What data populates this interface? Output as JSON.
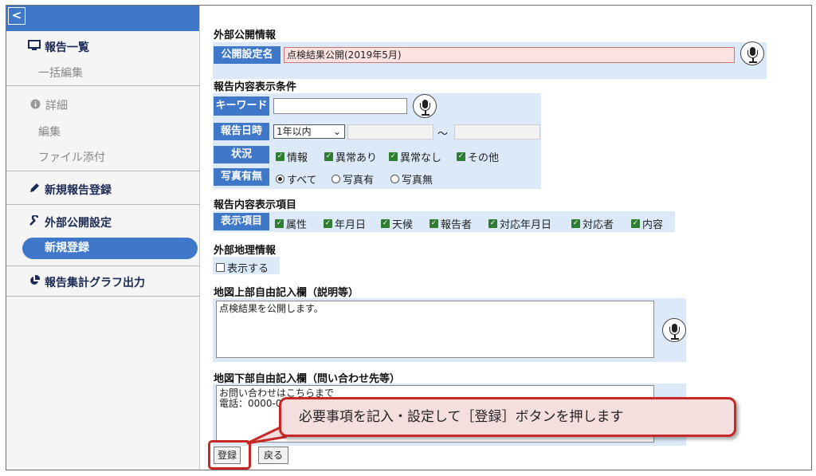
{
  "sidebar": {
    "back_glyph": "<",
    "items": [
      {
        "label": "報告一覧",
        "icon": "monitor-icon"
      },
      {
        "label": "一括編集"
      },
      {
        "label": "詳細",
        "icon": "info-icon"
      },
      {
        "label": "編集"
      },
      {
        "label": "ファイル添付"
      },
      {
        "label": "新規報告登録",
        "icon": "pencil-icon"
      },
      {
        "label": "外部公開設定",
        "icon": "wrench-icon"
      },
      {
        "label": "新規登録"
      },
      {
        "label": "報告集計グラフ出力",
        "icon": "pie-chart-icon"
      }
    ]
  },
  "form": {
    "section_public_info": "外部公開情報",
    "public_name_label": "公開設定名",
    "public_name_value": "点検結果公開(2019年5月)",
    "section_conditions": "報告内容表示条件",
    "keyword_label": "キーワード",
    "keyword_value": "",
    "date_label": "報告日時",
    "date_select": "1年以内",
    "date_tilde": "～",
    "status_label": "状況",
    "status_options": [
      "情報",
      "異常あり",
      "異常なし",
      "その他"
    ],
    "photo_label": "写真有無",
    "photo_options": [
      "すべて",
      "写真有",
      "写真無"
    ],
    "section_items": "報告内容表示項目",
    "items_label": "表示項目",
    "item_options": [
      "属性",
      "年月日",
      "天候",
      "報告者",
      "対応年月日",
      "対応者",
      "内容"
    ],
    "section_geo": "外部地理情報",
    "geo_checkbox": "表示する",
    "section_map_top": "地図上部自由記入欄（説明等）",
    "map_top_text": "点検結果を公開します。",
    "section_map_bottom": "地図下部自由記入欄（問い合わせ先等）",
    "map_bottom_text": "お問い合わせはこちらまで\n電話：0000-0",
    "register_button": "登録",
    "back_button": "戻る"
  },
  "callout": "必要事項を記入・設定して［登録］ボタンを押します",
  "colors": {
    "accent": "#3f78c8",
    "highlight": "#c62828",
    "row_bg": "#dce9f8"
  }
}
